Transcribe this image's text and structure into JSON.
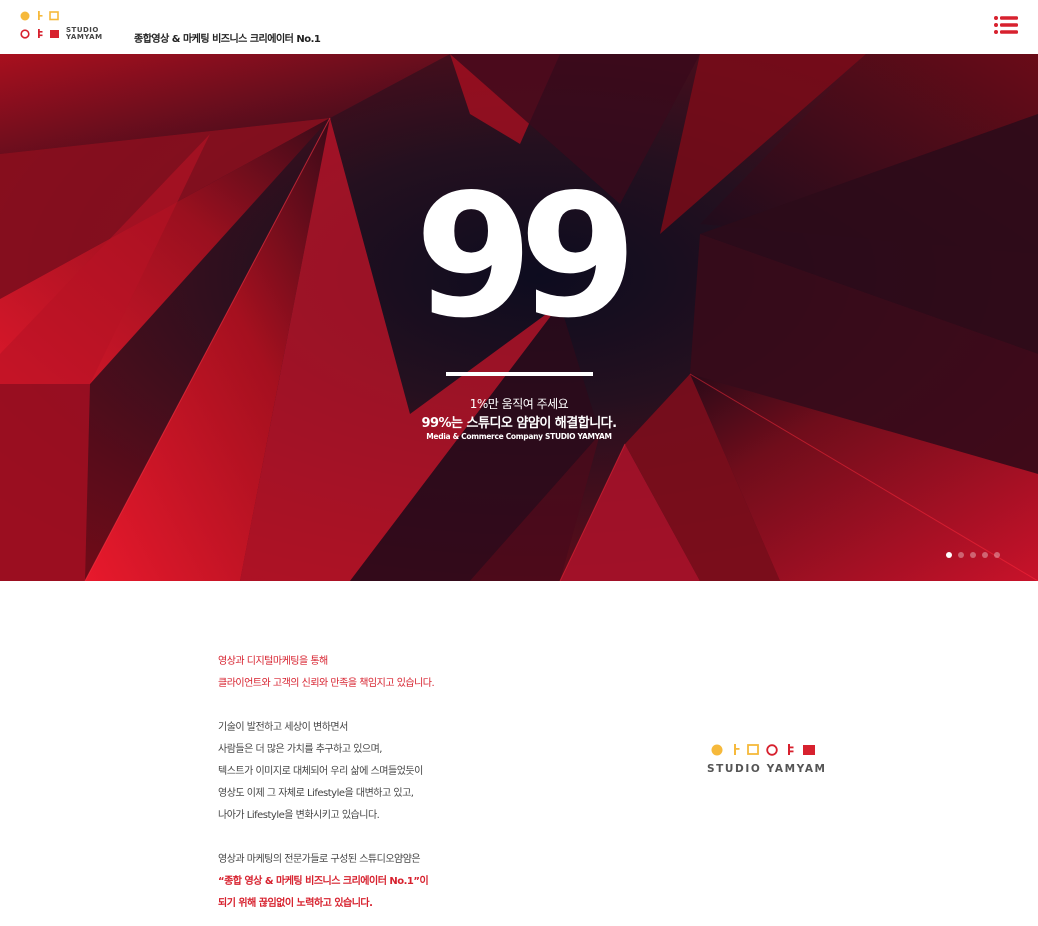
{
  "header": {
    "logo_text_line1": "STUDIO",
    "logo_text_line2": "YAMYAM",
    "tagline": "종합영상 & 마케팅 비즈니스 크리에이터 No.1",
    "menu_icon": "hamburger-list-icon"
  },
  "hero": {
    "number": "99",
    "line1": "1%만 움직여 주세요",
    "line2": "99%는 스튜디오 얌얌이 해결합니다.",
    "line3": "Media & Commerce Company STUDIO YAMYAM",
    "slide_count": 5,
    "active_slide": 1
  },
  "intro": {
    "para1": [
      "영상과 디지털마케팅을 통해",
      "클라이언트와 고객의 신뢰와 만족을 책임지고 있습니다."
    ],
    "para2": [
      "기술이 발전하고 세상이 변하면서",
      "사람들은 더 많은 가치를 추구하고 있으며,",
      "텍스트가 이미지로 대체되어 우리 삶에 스며들었듯이",
      "영상도 이제 그 자체로 Lifestyle을 대변하고 있고,",
      "나아가 Lifestyle을 변화시키고 있습니다."
    ],
    "para3": [
      "영상과 마케팅의 전문가들로 구성된 스튜디오얌얌은",
      "“종합 영상 & 마케팅 비즈니스 크리에이터 No.1”이",
      "되기 위해 끊임없이 노력하고 있습니다."
    ],
    "logo_text": "STUDIO YAMYAM"
  },
  "colors": {
    "brand_red": "#d7212e",
    "brand_yellow": "#f6b93b"
  }
}
